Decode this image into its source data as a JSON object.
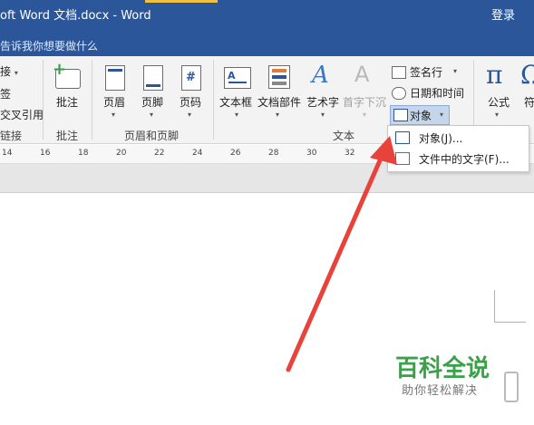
{
  "titlebar": {
    "title": "oft Word 文档.docx  -  Word",
    "login": "登录"
  },
  "tellme": {
    "placeholder": "告诉我你想要做什么"
  },
  "ribbon": {
    "links_group": {
      "items": [
        "接",
        "签",
        "交叉引用"
      ],
      "label": "链接"
    },
    "comments_group": {
      "comment_label": "批注",
      "label": "批注"
    },
    "header_footer_group": {
      "header_label": "页眉",
      "footer_label": "页脚",
      "page_number_label": "页码",
      "label": "页眉和页脚",
      "page_number_glyph": "#"
    },
    "text_group": {
      "textbox_label": "文本框",
      "quickparts_label": "文档部件",
      "wordart_label": "艺术字",
      "dropcap_label": "首字下沉",
      "wordart_glyph": "A",
      "dropcap_glyph": "A",
      "signature_label": "签名行",
      "datetime_label": "日期和时间",
      "object_label": "对象",
      "label": "文本"
    },
    "symbols_group": {
      "equation_label": "公式",
      "equation_glyph": "π",
      "symbol_partial": "符",
      "omega_glyph": "Ω"
    }
  },
  "ruler": {
    "ticks": [
      "14",
      "16",
      "18",
      "20",
      "22",
      "24",
      "26",
      "28",
      "30",
      "32"
    ]
  },
  "dropdown": {
    "items": [
      {
        "label": "对象(J)...",
        "icon": "object-icon"
      },
      {
        "label": "文件中的文字(F)...",
        "icon": "text-from-file-icon"
      }
    ]
  },
  "annotation": {
    "arrow_color": "#e8433a"
  },
  "watermark": {
    "title": "百科全说",
    "subtitle": "助你轻松解决"
  },
  "colors": {
    "titlebar": "#2b579a",
    "ribbon": "#f3f3f3",
    "highlight": "#c5d5ea",
    "watermark_green": "#3aa04a"
  }
}
